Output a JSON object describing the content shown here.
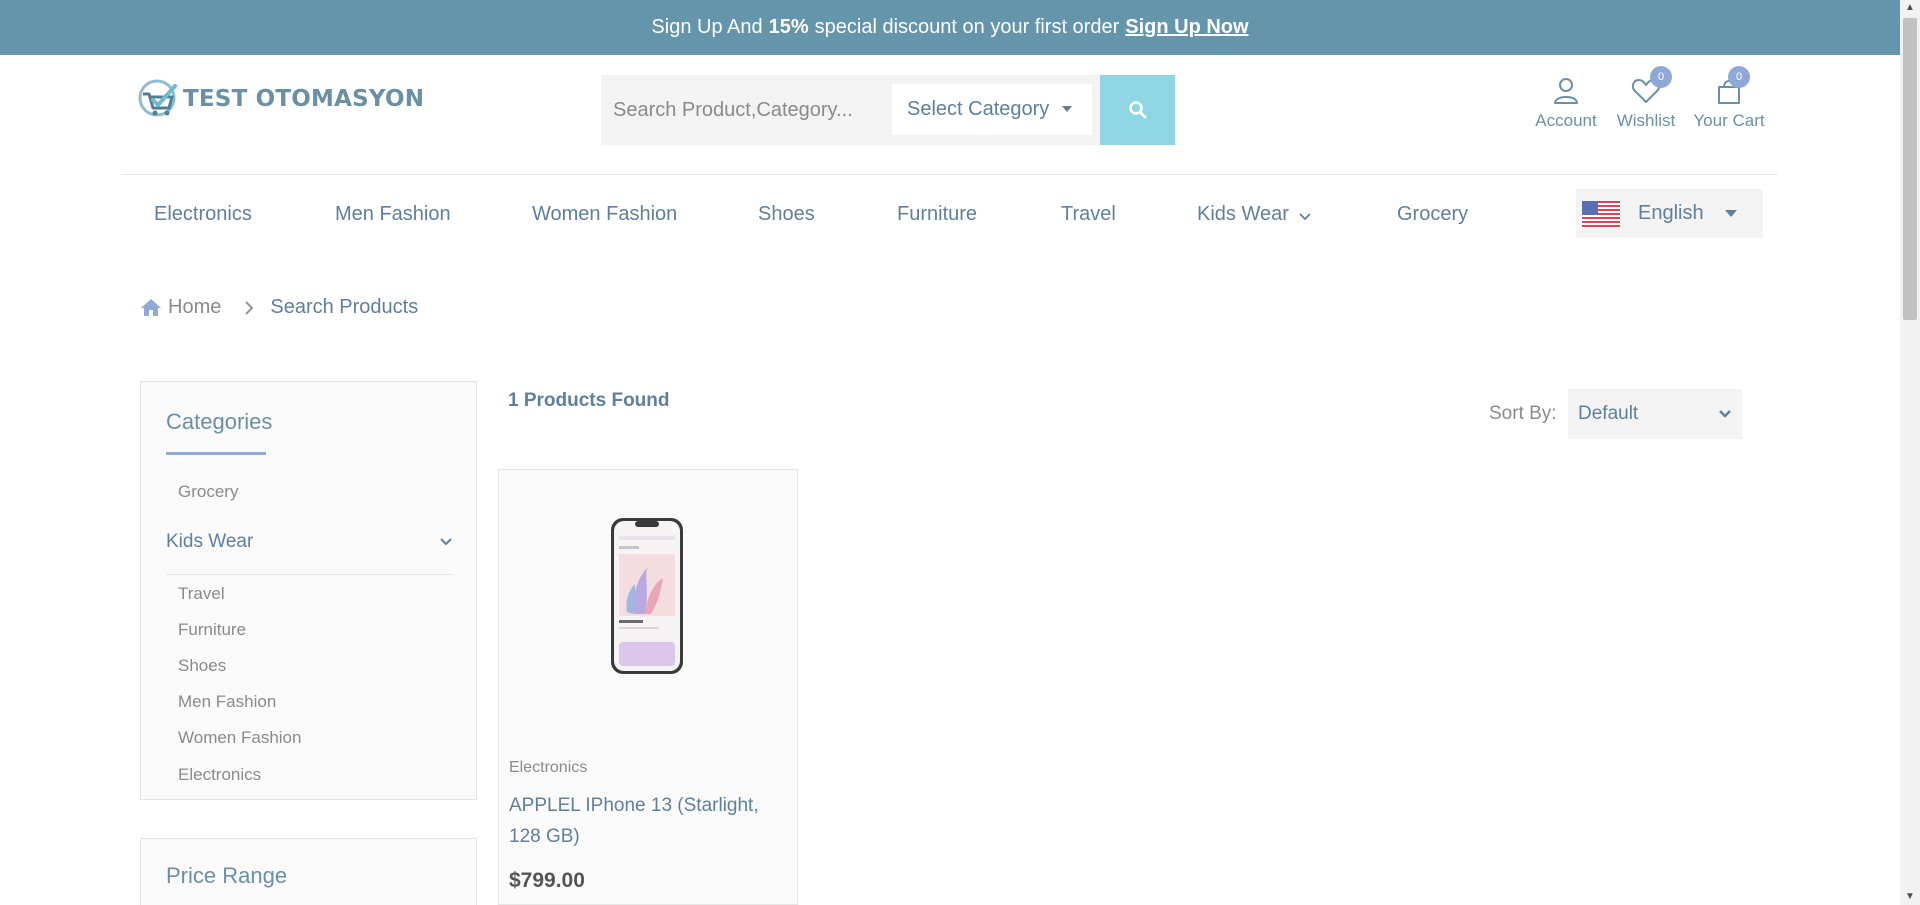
{
  "banner": {
    "prefix": "Sign Up And",
    "highlight": "15%",
    "suffix": "special discount on your first order",
    "link": "Sign Up Now"
  },
  "logo": {
    "text": "TEST OTOMASYON"
  },
  "search": {
    "placeholder": "Search Product,Category...",
    "category_label": "Select Category"
  },
  "header_icons": {
    "account": "Account",
    "wishlist": "Wishlist",
    "wishlist_count": "0",
    "cart": "Your Cart",
    "cart_count": "0"
  },
  "nav": {
    "items": [
      "Electronics",
      "Men Fashion",
      "Women Fashion",
      "Shoes",
      "Furniture",
      "Travel",
      "Kids Wear",
      "Grocery"
    ],
    "language": "English"
  },
  "breadcrumb": {
    "home": "Home",
    "current": "Search Products"
  },
  "sidebar": {
    "categories_title": "Categories",
    "categories": [
      "Grocery",
      "Kids Wear",
      "Travel",
      "Furniture",
      "Shoes",
      "Men Fashion",
      "Women Fashion",
      "Electronics"
    ],
    "price_title": "Price Range"
  },
  "results": {
    "found": "1 Products Found",
    "sort_label": "Sort By:",
    "sort_value": "Default"
  },
  "product": {
    "category": "Electronics",
    "name_line1": "APPLEL IPhone 13 (Starlight,",
    "name_line2": "128 GB)",
    "price": "$799.00"
  },
  "colors": {
    "banner": "#6495aa",
    "search_button": "#8ed6e3",
    "badge": "#8fa8d6",
    "text": "#5f7f9a"
  }
}
